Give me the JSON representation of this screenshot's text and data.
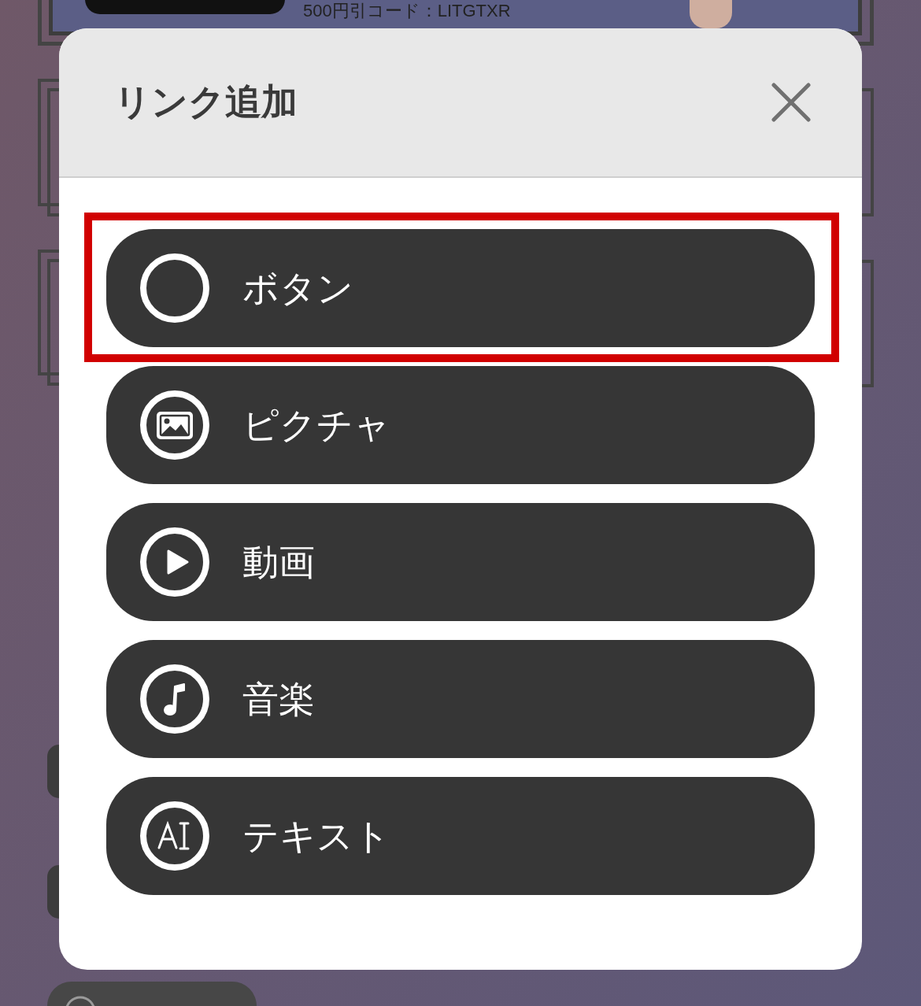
{
  "background": {
    "banner_code": "500円引コード：LITGTXR"
  },
  "dialog": {
    "title": "リンク追加",
    "options": [
      {
        "kind": "button",
        "label": "ボタン",
        "highlighted": true
      },
      {
        "kind": "picture",
        "label": "ピクチャ",
        "highlighted": false
      },
      {
        "kind": "video",
        "label": "動画",
        "highlighted": false
      },
      {
        "kind": "music",
        "label": "音楽",
        "highlighted": false
      },
      {
        "kind": "text",
        "label": "テキスト",
        "highlighted": false
      }
    ]
  }
}
